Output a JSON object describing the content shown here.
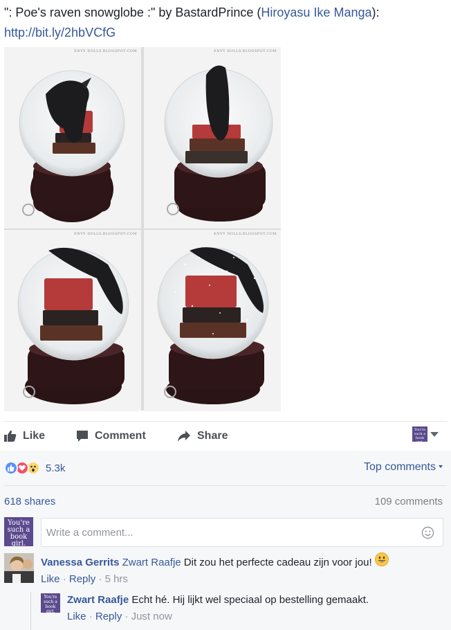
{
  "post": {
    "text_prefix": "\": Poe's raven snowglobe :\" by BastardPrince (",
    "text_author_link": "Hiroyasu Ike Manga",
    "text_suffix": "):",
    "url": "http://bit.ly/2hbVCfG"
  },
  "photos": {
    "watermark": "ENVY DOLLS.BLOGSPOT.COM"
  },
  "actions": {
    "like": "Like",
    "comment": "Comment",
    "share": "Share"
  },
  "page_avatar_text": "You're such a book girl.",
  "reactions": {
    "count": "5.3k",
    "types": [
      "like",
      "love",
      "wow"
    ]
  },
  "top_comments_label": "Top comments",
  "stats": {
    "shares": "618 shares",
    "comments": "109 comments"
  },
  "comment_input": {
    "placeholder": "Write a comment..."
  },
  "comments": [
    {
      "author": "Vanessa Gerrits",
      "tag": "Zwart Raafje",
      "text": "Dit zou het perfecte cadeau zijn voor jou!",
      "like_label": "Like",
      "reply_label": "Reply",
      "time": "5 hrs",
      "replies": [
        {
          "author": "Zwart Raafje",
          "text": "Echt hé. Hij lijkt wel speciaal op bestelling gemaakt.",
          "like_label": "Like",
          "reply_label": "Reply",
          "time": "Just now"
        }
      ]
    }
  ],
  "colors": {
    "link": "#365899",
    "text": "#1d2129",
    "muted": "#90949c",
    "page_avatar": "#5b4a8e",
    "reaction_like": "#5890ff",
    "reaction_love": "#f25268",
    "reaction_wow": "#fcd86a"
  }
}
